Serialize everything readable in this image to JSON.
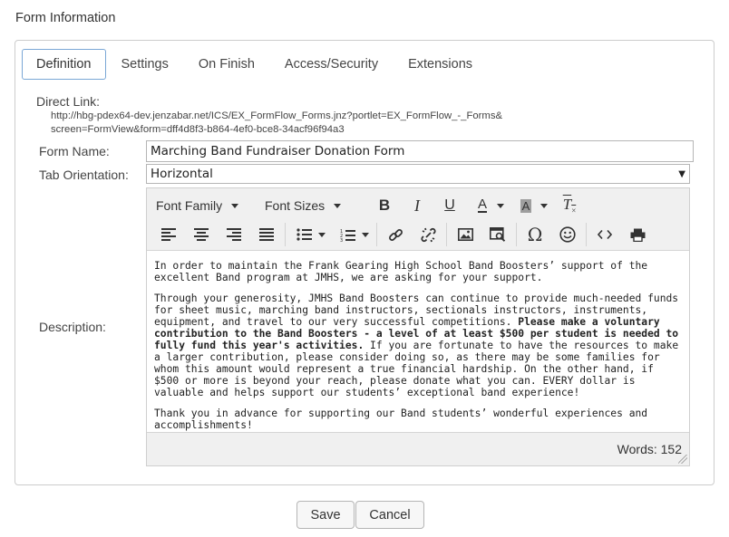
{
  "page_title": "Form Information",
  "tabs": [
    {
      "label": "Definition",
      "active": true
    },
    {
      "label": "Settings",
      "active": false
    },
    {
      "label": "On Finish",
      "active": false
    },
    {
      "label": "Access/Security",
      "active": false
    },
    {
      "label": "Extensions",
      "active": false
    }
  ],
  "direct_link": {
    "label": "Direct Link:",
    "url": "http://hbg-pdex64-dev.jenzabar.net/ICS/EX_FormFlow_Forms.jnz?portlet=EX_FormFlow_-_Forms&screen=FormView&form=dff4d8f3-b864-4ef0-bce8-34acf96f94a3"
  },
  "form_name": {
    "label": "Form Name:",
    "value": "Marching Band Fundraiser Donation Form"
  },
  "tab_orientation": {
    "label": "Tab Orientation:",
    "value": "Horizontal"
  },
  "description": {
    "label": "Description:",
    "toolbar": {
      "font_family": "Font Family",
      "font_sizes": "Font Sizes"
    },
    "paragraphs": {
      "p1": "In order to maintain the Frank Gearing High School Band Boosters’ support of the excellent Band program at JMHS, we are asking for your support.",
      "p2_start": "Through your generosity, JMHS Band Boosters can continue to provide much-needed funds for sheet music, marching band instructors, sectionals instructors, instruments, equipment, and travel to our very successful competitions. ",
      "p2_bold": "Please make a voluntary contribution to the Band Boosters - a level of at least $500 per student is needed to fully fund this year's activities.",
      "p2_end": " If you are fortunate to have the resources to make a larger contribution, please consider doing so, as there may be some families for whom this amount would represent a true financial hardship.  On the other hand, if $500 or more is beyond your reach, please donate what you can. EVERY dollar is valuable and helps support our students’ exceptional band experience!",
      "p3": "Thank you in advance for supporting our Band students’ wonderful experiences and accomplishments!"
    },
    "word_count": "Words: 152"
  },
  "buttons": {
    "save": "Save",
    "cancel": "Cancel"
  },
  "colors": {
    "active_tab_border": "#7aa7d6",
    "toolbar_bg": "#f0f0f0"
  }
}
